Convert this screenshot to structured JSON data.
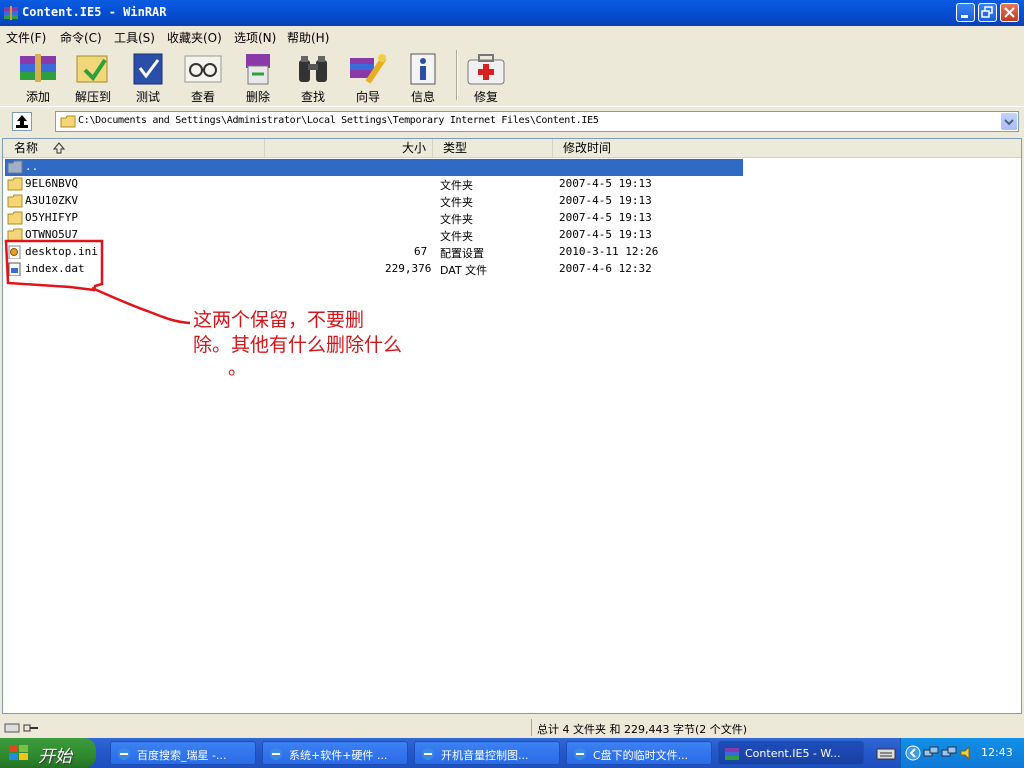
{
  "window": {
    "title": "Content.IE5 - WinRAR"
  },
  "menu": [
    "文件(F)",
    "命令(C)",
    "工具(S)",
    "收藏夹(O)",
    "选项(N)",
    "帮助(H)"
  ],
  "toolbar": [
    "添加",
    "解压到",
    "测试",
    "查看",
    "删除",
    "查找",
    "向导",
    "信息",
    "修复"
  ],
  "address": {
    "path": "C:\\Documents and Settings\\Administrator\\Local Settings\\Temporary Internet Files\\Content.IE5"
  },
  "columns": {
    "name": "名称",
    "size": "大小",
    "type": "类型",
    "modified": "修改时间"
  },
  "files": [
    {
      "name": "..",
      "size": "",
      "type": "",
      "modified": "",
      "kind": "parent",
      "selected": true
    },
    {
      "name": "9EL6NBVQ",
      "size": "",
      "type": "文件夹",
      "modified": "2007-4-5 19:13",
      "kind": "folder"
    },
    {
      "name": "A3U10ZKV",
      "size": "",
      "type": "文件夹",
      "modified": "2007-4-5 19:13",
      "kind": "folder"
    },
    {
      "name": "O5YHIFYP",
      "size": "",
      "type": "文件夹",
      "modified": "2007-4-5 19:13",
      "kind": "folder"
    },
    {
      "name": "OTWNO5U7",
      "size": "",
      "type": "文件夹",
      "modified": "2007-4-5 19:13",
      "kind": "folder"
    },
    {
      "name": "desktop.ini",
      "size": "67",
      "type": "配置设置",
      "modified": "2010-3-11 12:26",
      "kind": "ini"
    },
    {
      "name": "index.dat",
      "size": "229,376",
      "type": "DAT 文件",
      "modified": "2007-4-6 12:32",
      "kind": "dat"
    }
  ],
  "annotation": {
    "line1": "这两个保留，不要删",
    "line2": "除。其他有什么删除什么",
    "line3": "。",
    "color": "#d4161b"
  },
  "status": {
    "text": "总计 4 文件夹 和 229,443 字节(2 个文件)"
  },
  "taskbar": {
    "start": "开始",
    "tasks": [
      "百度搜索_瑞星 -...",
      "系统+软件+硬件 ...",
      "开机音量控制图...",
      "C盘下的临时文件...",
      "Content.IE5 - W..."
    ],
    "clock": "12:43"
  }
}
